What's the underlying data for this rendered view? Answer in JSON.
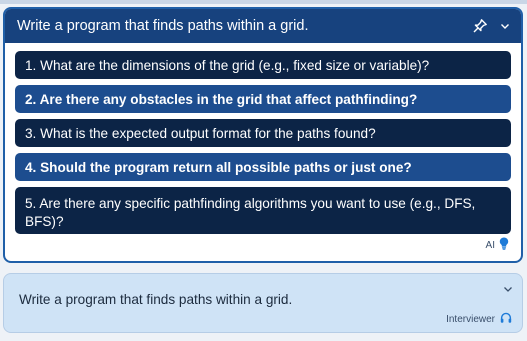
{
  "ai_panel": {
    "title": "Write a program that finds paths within a grid.",
    "questions": [
      "1. What are the dimensions of the grid (e.g., fixed size or variable)?",
      "2. Are there any obstacles in the grid that affect pathfinding?",
      "3. What is the expected output format for the paths found?",
      "4. Should the program return all possible paths or just one?",
      "5. Are there any specific pathfinding algorithms you want to use (e.g., DFS, BFS)?"
    ],
    "footer_label": "AI",
    "icons": {
      "pin": "pin-icon",
      "collapse": "chevron-down-icon",
      "badge": "lightbulb-icon"
    }
  },
  "interviewer_panel": {
    "text": "Write a program that finds paths within a grid.",
    "footer_label": "Interviewer",
    "icons": {
      "collapse": "chevron-down-icon",
      "badge": "headphones-icon"
    }
  },
  "colors": {
    "header": "#17427e",
    "question_dark": "#0c2446",
    "question_highlight": "#1d4d8f",
    "panel_border": "#1f5fa8",
    "interviewer_bg": "#cfe3f6",
    "accent_icon": "#1e7bd8"
  }
}
